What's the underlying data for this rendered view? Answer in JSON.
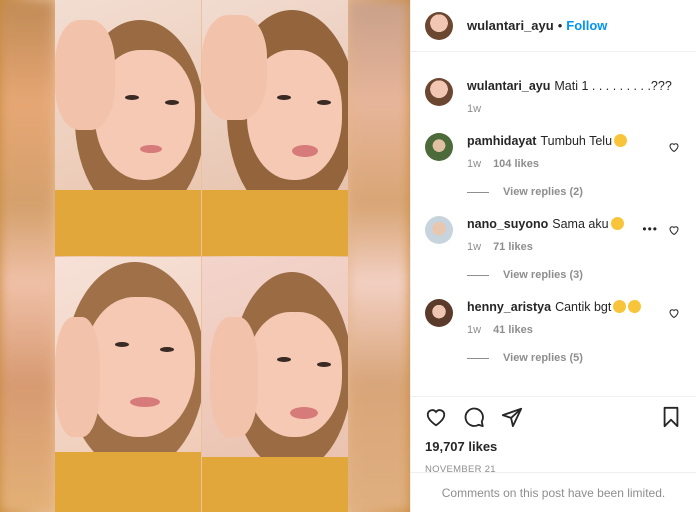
{
  "post": {
    "author": "wulantari_ayu",
    "separator": "•",
    "follow_label": "Follow",
    "caption_user": "wulantari_ayu",
    "caption_text": "Mati 1 . . . . . . . . .???",
    "caption_time": "1w"
  },
  "comments": [
    {
      "user": "pamhidayat",
      "text": "Tumbuh Telu",
      "emoji": "laughing-face",
      "time": "1w",
      "likes": "104 likes",
      "replies": "View replies (2)"
    },
    {
      "user": "nano_suyono",
      "text": "Sama aku",
      "emoji": "grinning-face",
      "time": "1w",
      "likes": "71 likes",
      "replies": "View replies (3)",
      "more": "•••"
    },
    {
      "user": "henny_aristya",
      "text": "Cantik bgt",
      "emoji": "heart-eyes-face",
      "time": "1w",
      "likes": "41 likes",
      "replies": "View replies (5)"
    }
  ],
  "footer": {
    "likes": "19,707 likes",
    "date": "NOVEMBER 21",
    "limited_notice": "Comments on this post have been limited."
  },
  "colors": {
    "follow": "#0095f6",
    "muted": "#8e8e8e",
    "text": "#262626"
  }
}
